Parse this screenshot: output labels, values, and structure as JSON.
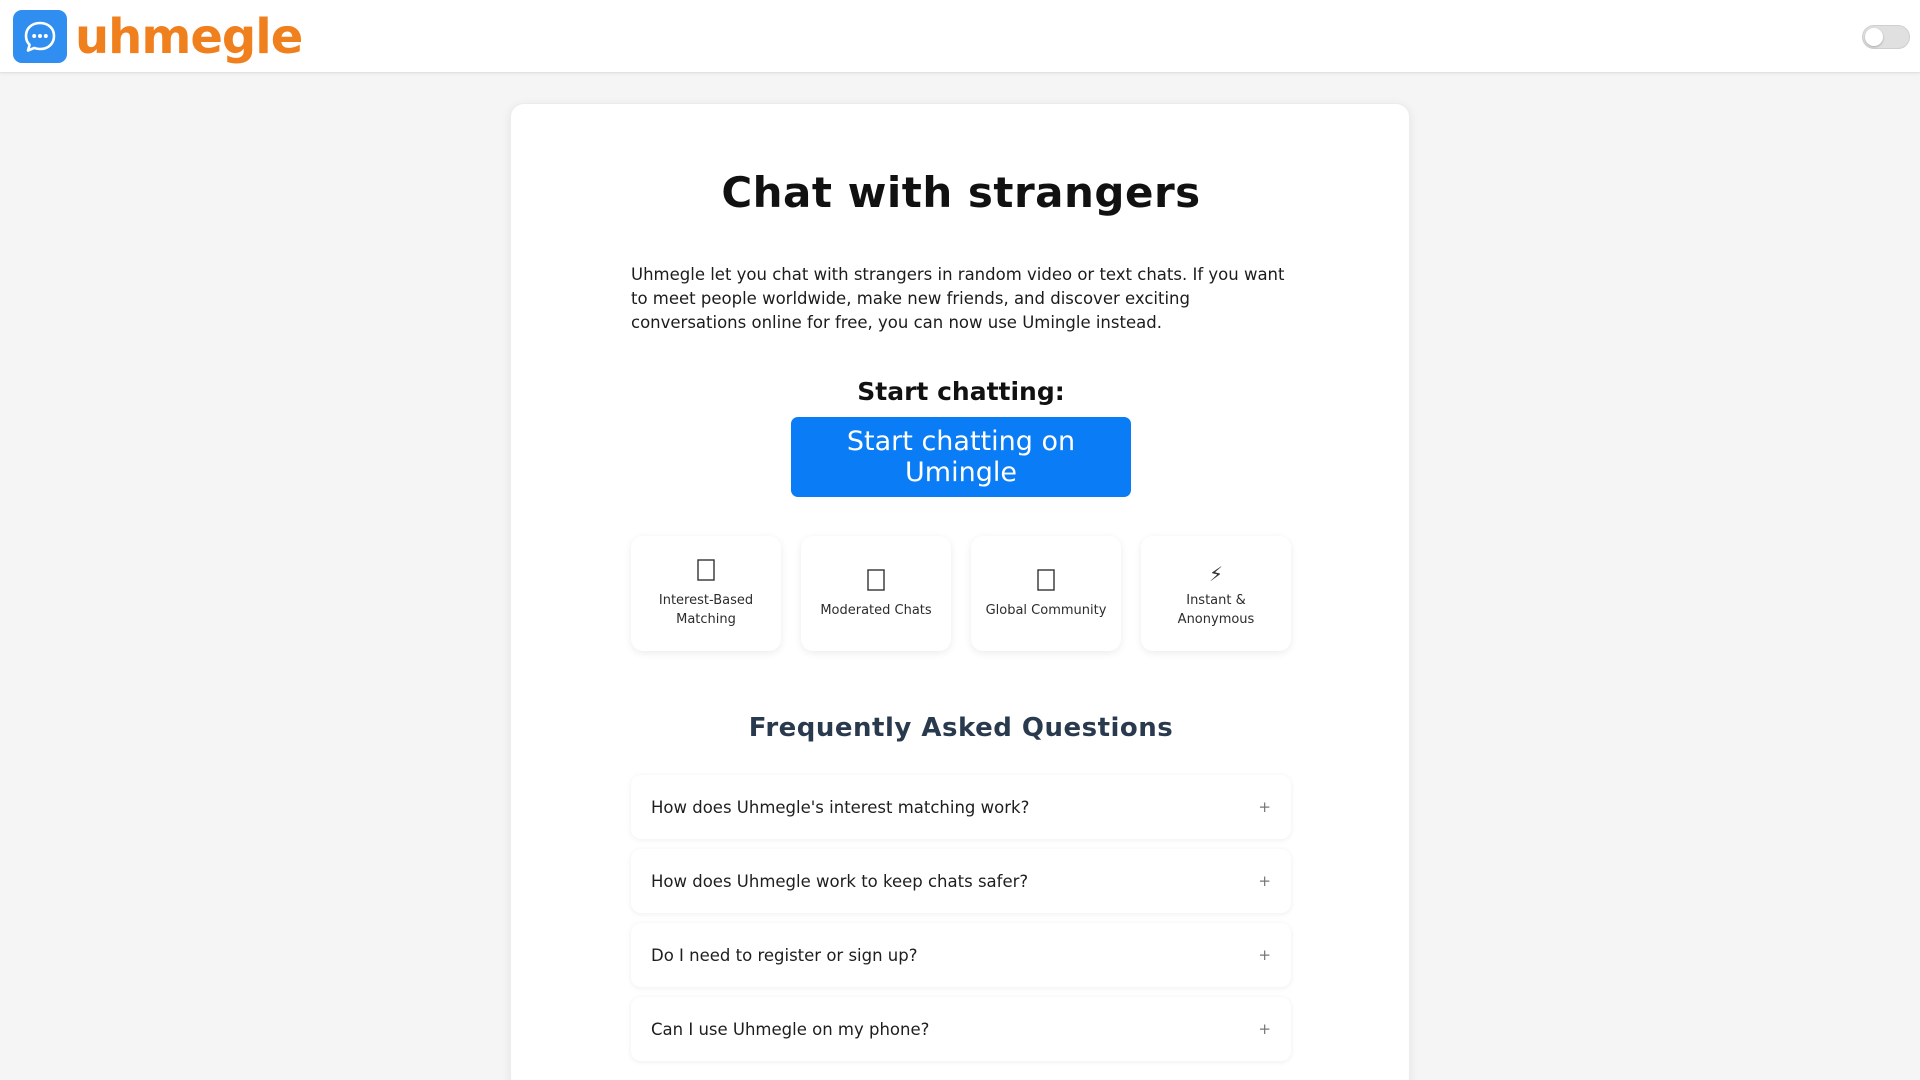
{
  "brand": {
    "name": "uhmegle",
    "logo_color": "#2f8ef0",
    "text_color": "#f07f1d"
  },
  "header": {
    "theme_toggle": {
      "icon": "toggle-switch",
      "state": "off"
    }
  },
  "main": {
    "title": "Chat with strangers",
    "intro": "Uhmegle let you chat with strangers in random video or text chats. If you want to meet people worldwide, make new friends, and discover exciting conversations online for free, you can now use Umingle instead.",
    "start_heading": "Start chatting:",
    "start_button": "Start chatting on Umingle",
    "accent_color": "#0a7cf5"
  },
  "features": [
    {
      "icon": "tag-icon",
      "label": "Interest-Based Matching"
    },
    {
      "icon": "shield-icon",
      "label": "Moderated Chats"
    },
    {
      "icon": "globe-icon",
      "label": "Global Community"
    },
    {
      "icon": "lightning-icon",
      "glyph": "⚡",
      "label": "Instant & Anonymous"
    }
  ],
  "faq": {
    "heading": "Frequently Asked Questions",
    "items": [
      {
        "question": "How does Uhmegle's interest matching work?",
        "toggle": "+"
      },
      {
        "question": "How does Uhmegle work to keep chats safer?",
        "toggle": "+"
      },
      {
        "question": "Do I need to register or sign up?",
        "toggle": "+"
      },
      {
        "question": "Can I use Uhmegle on my phone?",
        "toggle": "+"
      }
    ]
  }
}
